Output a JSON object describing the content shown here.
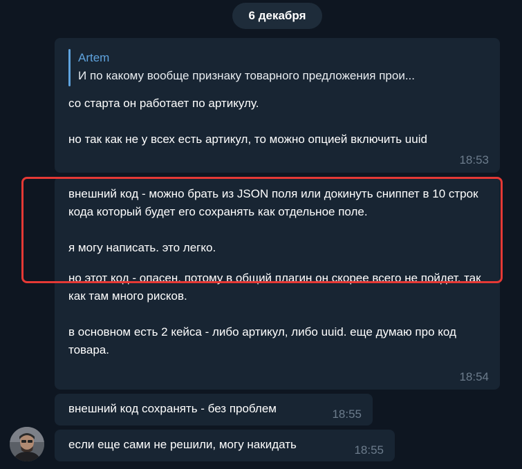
{
  "date_separator": "6 декабря",
  "group1": {
    "reply": {
      "author": "Artem",
      "text": "И по какому вообще признаку товарного предложения прои..."
    },
    "text": "со старта он работает по артикулу.\n\nно так как не у всех есть артикул, то можно опцией включить uuid",
    "time": "18:53"
  },
  "group2": {
    "highlighted_text": "внешний код - можно брать из JSON поля или докинуть сниппет в 10 строк кода который будет его сохранять как отдельное поле.\n\nя могу написать. это легко.",
    "text": "но этот код - опасен. потому в общий плагин он скорее всего не пойдет. так как там много рисков.\n\nв основном есть 2 кейса - либо артикул, либо uuid. еще думаю про код товара.",
    "time": "18:54"
  },
  "msg3": {
    "text": "внешний код сохранять - без проблем",
    "time": "18:55"
  },
  "msg4": {
    "text": "если еще сами не решили, могу накидать",
    "time": "18:55"
  },
  "colors": {
    "background": "#0e1621",
    "bubble": "#182533",
    "accent": "#5fa3de",
    "highlight": "#e53935",
    "timestamp": "#6c7c8c"
  }
}
